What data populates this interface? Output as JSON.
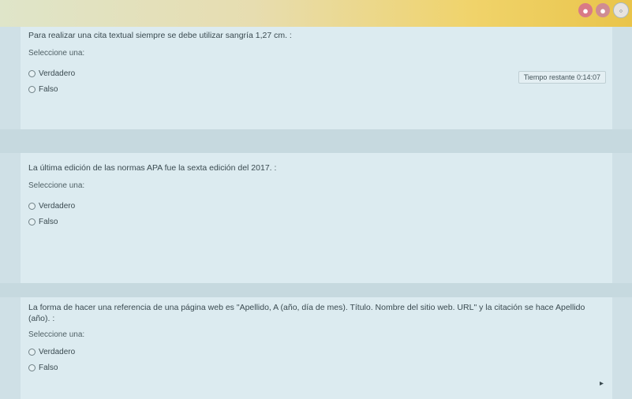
{
  "top_icons": [
    "user-icon",
    "people-icon",
    "settings-icon"
  ],
  "timer": {
    "label": "Tiempo restante 0:14:07"
  },
  "questions": [
    {
      "text": "Para realizar una cita textual siempre se debe utilizar sangría 1,27 cm. :",
      "prompt": "Seleccione una:",
      "options": [
        "Verdadero",
        "Falso"
      ]
    },
    {
      "text": "La última edición de las normas APA fue la sexta edición del 2017. :",
      "prompt": "Seleccione una:",
      "options": [
        "Verdadero",
        "Falso"
      ]
    },
    {
      "text": "La forma de hacer una referencia de una página web es \"Apellido, A (año, día de mes). Título. Nombre del sitio web. URL\" y la citación se hace Apellido (año). :",
      "prompt": "Seleccione una:",
      "options": [
        "Verdadero",
        "Falso"
      ]
    }
  ]
}
